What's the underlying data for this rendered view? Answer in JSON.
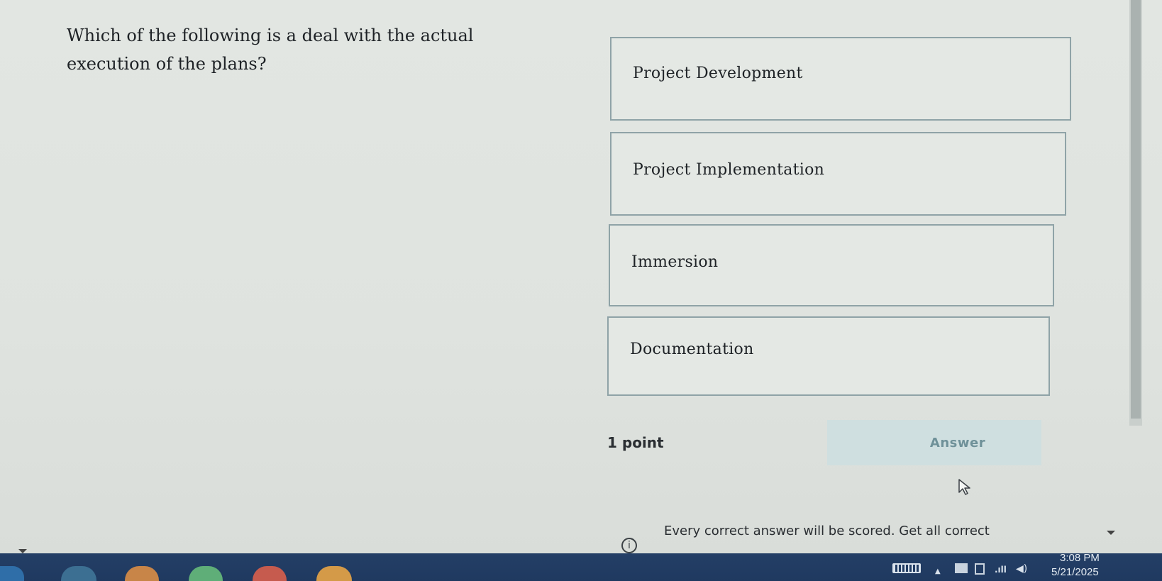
{
  "quiz": {
    "question": "Which of the following is a deal with the actual execution of the plans?",
    "options": [
      {
        "label": "Project Development"
      },
      {
        "label": "Project Implementation"
      },
      {
        "label": "Immersion"
      },
      {
        "label": "Documentation"
      }
    ],
    "points": "1 point",
    "answer_button": "Answer",
    "notice": "Every correct answer will be scored. Get all correct"
  },
  "icons": {
    "info": "i",
    "cursor": "mouse-pointer-icon"
  },
  "taskbar": {
    "tray": {
      "chevron": "▲",
      "signal": ".ıll",
      "volume": "◀)"
    },
    "clock": {
      "time": "3:08 PM",
      "date": "5/21/2025"
    }
  },
  "colors": {
    "background": "#dde2de",
    "option_border": "#8fa3a7",
    "answer_button_bg": "#cfdfe0",
    "answer_button_text": "#6f9199",
    "taskbar": "#243f66"
  }
}
